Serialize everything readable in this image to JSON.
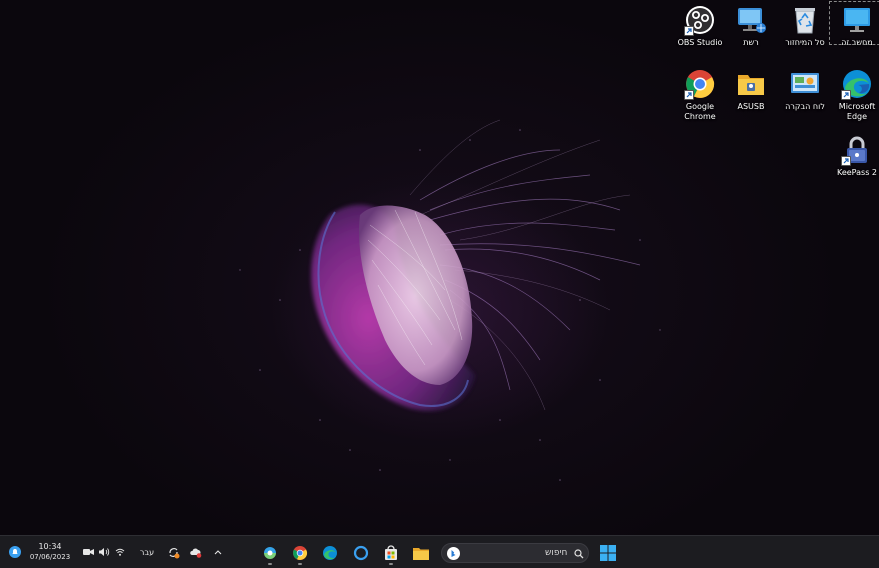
{
  "desktop": {
    "icons": [
      {
        "id": "obs",
        "label": "OBS Studio",
        "icon": "obs-icon"
      },
      {
        "id": "network",
        "label": "רשת",
        "icon": "network-icon"
      },
      {
        "id": "recycle",
        "label": "סל המיחזור",
        "icon": "recycle-bin-icon"
      },
      {
        "id": "thispc",
        "label": "מחשב זה",
        "icon": "this-pc-icon"
      },
      {
        "id": "chrome",
        "label": "Google Chrome",
        "icon": "chrome-icon"
      },
      {
        "id": "asus",
        "label": "ASUSB",
        "icon": "folder-icon"
      },
      {
        "id": "control",
        "label": "לוח הבקרה",
        "icon": "control-panel-icon"
      },
      {
        "id": "edge",
        "label": "Microsoft Edge",
        "icon": "edge-icon"
      },
      {
        "id": "keepass",
        "label": "KeePass 2",
        "icon": "keepass-icon"
      }
    ]
  },
  "taskbar": {
    "clock_time": "10:34",
    "clock_date": "07/06/2023",
    "language": "עבר",
    "search_placeholder": "חיפוש",
    "pinned": [
      "copilot-icon",
      "chrome-icon",
      "edge-icon",
      "cortana-icon",
      "store-icon",
      "file-explorer-icon"
    ],
    "start_icon": "windows-start-icon",
    "colors": {
      "taskbar": "#1c1c20",
      "accent": "#3aa0f0"
    }
  }
}
